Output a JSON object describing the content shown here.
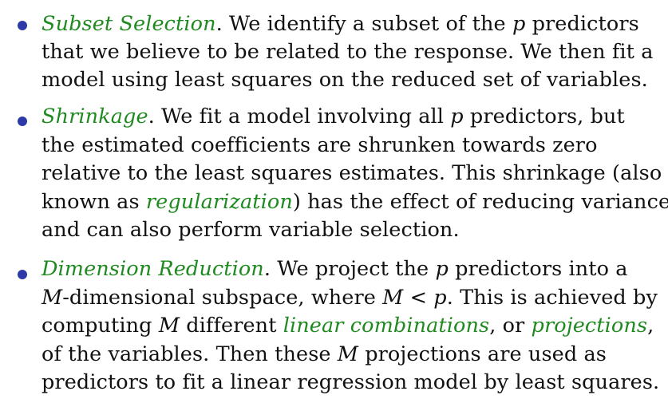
{
  "colors": {
    "bullet": "#2b3aa8",
    "emphasis_green": "#1f8a1f",
    "text": "#111111"
  },
  "items": [
    {
      "term": "Subset Selection",
      "lines": [
        {
          "after_term": ". We identify a subset of the ",
          "var": "p",
          "tail": " predictors"
        },
        {
          "text": "that we believe to be related to the response. We then fit a"
        },
        {
          "text": "model using least squares on the reduced set of variables."
        }
      ]
    },
    {
      "term": "Shrinkage",
      "lines": [
        {
          "after_term": ". We fit a model involving all ",
          "var": "p",
          "tail": " predictors, but"
        },
        {
          "text": "the estimated coefficients are shrunken towards zero"
        },
        {
          "text": "relative to the least squares estimates. This shrinkage (also"
        },
        {
          "pre": "known as ",
          "green_term": "regularization",
          "post": ") has the effect of reducing variance"
        },
        {
          "text": "and can also perform variable selection."
        }
      ]
    },
    {
      "term": "Dimension Reduction",
      "lines": [
        {
          "after_term": ". We project the ",
          "var": "p",
          "tail": " predictors into a"
        },
        {
          "var1": "M",
          "mid1": "-dimensional subspace, where ",
          "var2": "M",
          "op": " < ",
          "var3": "p",
          "tail": ". This is achieved by"
        },
        {
          "pre": "computing ",
          "var": "M",
          "mid": " different ",
          "green1": "linear combinations",
          "sep": ", or ",
          "green2": "projections",
          "post": ","
        },
        {
          "pre": "of the variables. Then these ",
          "var": "M",
          "post": " projections are used as"
        },
        {
          "text": "predictors to fit a linear regression model by least squares."
        }
      ]
    }
  ]
}
